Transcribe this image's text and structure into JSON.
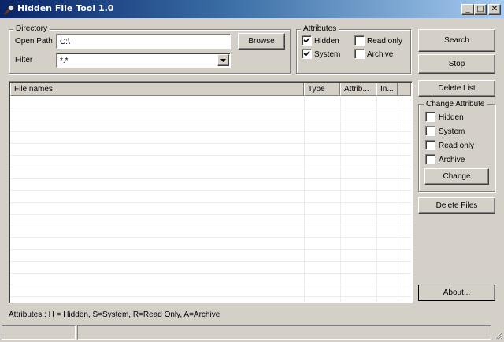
{
  "window": {
    "title": "Hidden File Tool 1.0",
    "minimize": "_",
    "maximize": "□",
    "close": "✕"
  },
  "directory": {
    "legend": "Directory",
    "open_path_label": "Open Path",
    "open_path_value": "C:\\",
    "browse": "Browse",
    "filter_label": "Filter",
    "filter_value": "*.*"
  },
  "attributes": {
    "legend": "Attributes",
    "hidden": {
      "label": "Hidden",
      "checked": true
    },
    "read_only": {
      "label": "Read only",
      "checked": false
    },
    "system": {
      "label": "System",
      "checked": true
    },
    "archive": {
      "label": "Archive",
      "checked": false
    }
  },
  "buttons": {
    "search": "Search",
    "stop": "Stop",
    "delete_list": "Delete List",
    "change": "Change",
    "delete_files": "Delete Files",
    "about": "About..."
  },
  "change_attribute": {
    "legend": "Change Attribute",
    "hidden": {
      "label": "Hidden",
      "checked": false
    },
    "system": {
      "label": "System",
      "checked": false
    },
    "read_only": {
      "label": "Read only",
      "checked": false
    },
    "archive": {
      "label": "Archive",
      "checked": false
    }
  },
  "list": {
    "columns": [
      "File names",
      "Type",
      "Attrib...",
      "In..."
    ],
    "rows": []
  },
  "footer": {
    "legend_text": "Attributes : H = Hidden, S=System, R=Read Only, A=Archive"
  },
  "colors": {
    "face": "#d4d0c8",
    "title_start": "#0a246a",
    "title_end": "#a6caf0"
  }
}
